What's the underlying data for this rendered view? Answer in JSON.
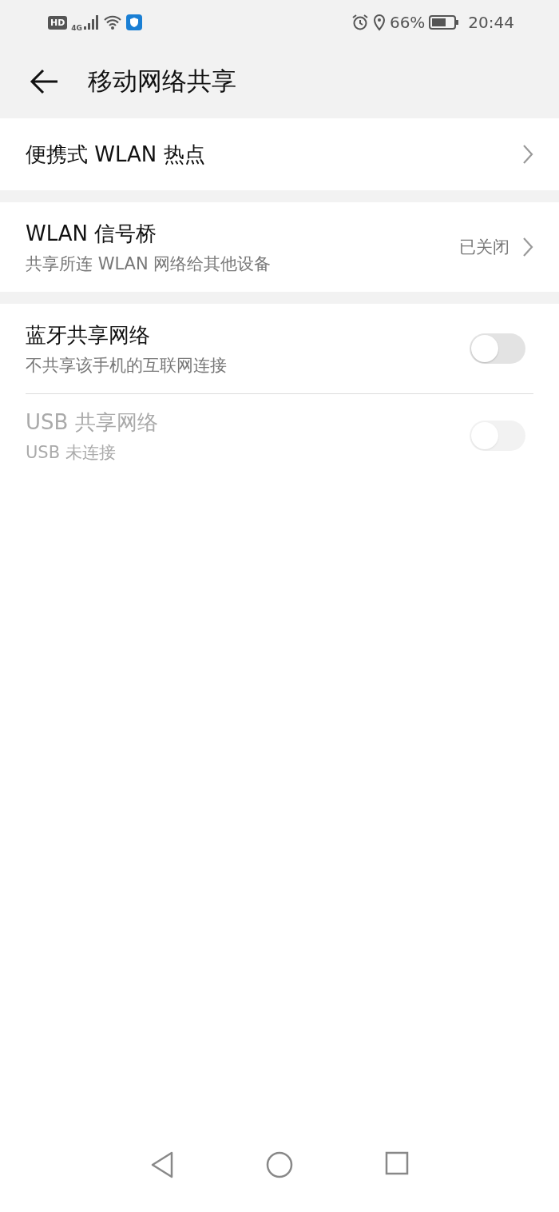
{
  "status_bar": {
    "hd": "HD",
    "network": "4G",
    "battery_percent": "66%",
    "time": "20:44"
  },
  "header": {
    "title": "移动网络共享"
  },
  "sections": [
    {
      "items": [
        {
          "kind": "link",
          "title": "便携式 WLAN 热点"
        }
      ]
    },
    {
      "items": [
        {
          "kind": "link",
          "title": "WLAN 信号桥",
          "subtitle": "共享所连 WLAN 网络给其他设备",
          "value": "已关闭"
        }
      ]
    },
    {
      "items": [
        {
          "kind": "toggle",
          "title": "蓝牙共享网络",
          "subtitle": "不共享该手机的互联网连接",
          "on": false,
          "disabled": false
        },
        {
          "kind": "toggle",
          "title": "USB 共享网络",
          "subtitle": "USB 未连接",
          "on": false,
          "disabled": true
        }
      ]
    }
  ]
}
